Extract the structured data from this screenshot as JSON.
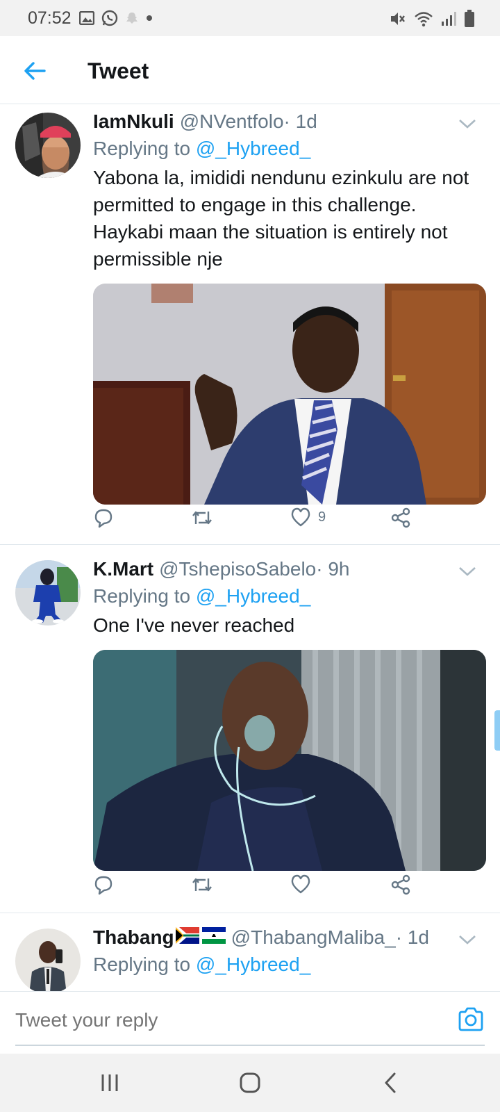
{
  "status_bar": {
    "time": "07:52",
    "left_icons": [
      "gallery-icon",
      "whatsapp-icon",
      "snapchat-icon",
      "dot-icon"
    ],
    "right_icons": [
      "mute-icon",
      "wifi-icon",
      "signal-icon",
      "battery-icon"
    ]
  },
  "header": {
    "back_icon": "arrow-left-icon",
    "title": "Tweet"
  },
  "tweets": [
    {
      "display_name": "IamNkuli",
      "handle": "@NVentfolo",
      "time": " · 1d",
      "replying_prefix": "Replying to ",
      "replying_to": "@_Hybreed_",
      "text": "Yabona la, imididi nendunu ezinkulu are not permitted to engage in this challenge. Haykabi maan the situation is entirely not permissible nje",
      "actions": {
        "reply_count": "",
        "retweet_count": "",
        "like_count": "9"
      }
    },
    {
      "display_name": "K.Mart",
      "handle": "@TshepisoSabelo",
      "time": " · 9h",
      "replying_prefix": "Replying to ",
      "replying_to": "@_Hybreed_",
      "text": "One I've never reached",
      "actions": {
        "reply_count": "",
        "retweet_count": "",
        "like_count": ""
      }
    },
    {
      "display_name": "Thabang",
      "handle": "@ThabangMaliba_",
      "time": " · 1d",
      "replying_prefix": "Replying to ",
      "replying_to": "@_Hybreed_",
      "text": "",
      "flags": [
        "south-africa-flag-icon",
        "lesotho-flag-icon"
      ]
    }
  ],
  "reply_bar": {
    "placeholder": "Tweet your reply",
    "camera_icon": "camera-icon"
  },
  "colors": {
    "accent": "#1da1f2",
    "secondary_text": "#657786",
    "primary_text": "#14171a",
    "divider": "#e1e8ed"
  }
}
